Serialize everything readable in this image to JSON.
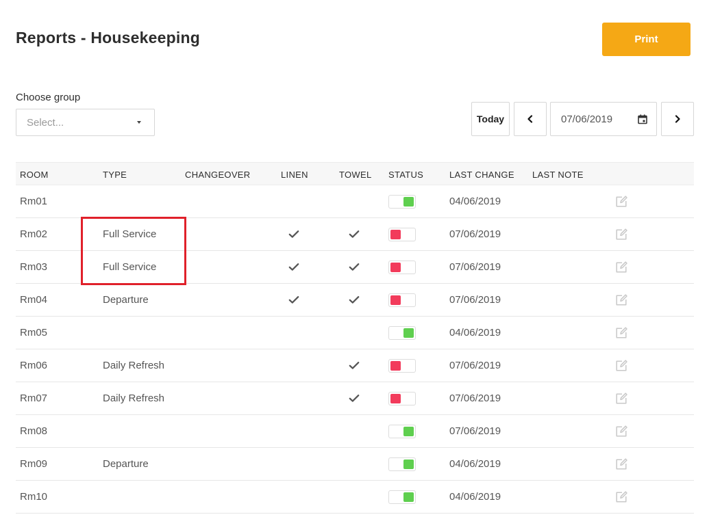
{
  "header": {
    "title": "Reports - Housekeeping",
    "print_label": "Print"
  },
  "group": {
    "label": "Choose group",
    "placeholder": "Select..."
  },
  "toolbar": {
    "today_label": "Today",
    "date": "07/06/2019"
  },
  "table": {
    "columns": [
      "ROOM",
      "TYPE",
      "CHANGEOVER",
      "LINEN",
      "TOWEL",
      "STATUS",
      "LAST CHANGE",
      "LAST NOTE"
    ],
    "rows": [
      {
        "room": "Rm01",
        "type": "",
        "changeover": false,
        "linen": false,
        "towel": false,
        "status": "on",
        "last_change": "04/06/2019",
        "last_note": ""
      },
      {
        "room": "Rm02",
        "type": "Full Service",
        "changeover": false,
        "linen": true,
        "towel": true,
        "status": "off",
        "last_change": "07/06/2019",
        "last_note": ""
      },
      {
        "room": "Rm03",
        "type": "Full Service",
        "changeover": false,
        "linen": true,
        "towel": true,
        "status": "off",
        "last_change": "07/06/2019",
        "last_note": ""
      },
      {
        "room": "Rm04",
        "type": "Departure",
        "changeover": false,
        "linen": true,
        "towel": true,
        "status": "off",
        "last_change": "07/06/2019",
        "last_note": ""
      },
      {
        "room": "Rm05",
        "type": "",
        "changeover": false,
        "linen": false,
        "towel": false,
        "status": "on",
        "last_change": "04/06/2019",
        "last_note": ""
      },
      {
        "room": "Rm06",
        "type": "Daily Refresh",
        "changeover": false,
        "linen": false,
        "towel": true,
        "status": "off",
        "last_change": "07/06/2019",
        "last_note": ""
      },
      {
        "room": "Rm07",
        "type": "Daily Refresh",
        "changeover": false,
        "linen": false,
        "towel": true,
        "status": "off",
        "last_change": "07/06/2019",
        "last_note": ""
      },
      {
        "room": "Rm08",
        "type": "",
        "changeover": false,
        "linen": false,
        "towel": false,
        "status": "on",
        "last_change": "07/06/2019",
        "last_note": ""
      },
      {
        "room": "Rm09",
        "type": "Departure",
        "changeover": false,
        "linen": false,
        "towel": false,
        "status": "on",
        "last_change": "04/06/2019",
        "last_note": ""
      },
      {
        "room": "Rm10",
        "type": "",
        "changeover": false,
        "linen": false,
        "towel": false,
        "status": "on",
        "last_change": "04/06/2019",
        "last_note": ""
      }
    ]
  },
  "colors": {
    "accent": "#f5a815",
    "status_on": "#5fcf4f",
    "status_off": "#f23b5b",
    "highlight": "#e0202a"
  },
  "icons": {
    "prev": "chevron-left-icon",
    "next": "chevron-right-icon",
    "calendar": "calendar-icon",
    "check": "check-icon",
    "edit": "edit-icon",
    "caret": "caret-down-icon"
  }
}
